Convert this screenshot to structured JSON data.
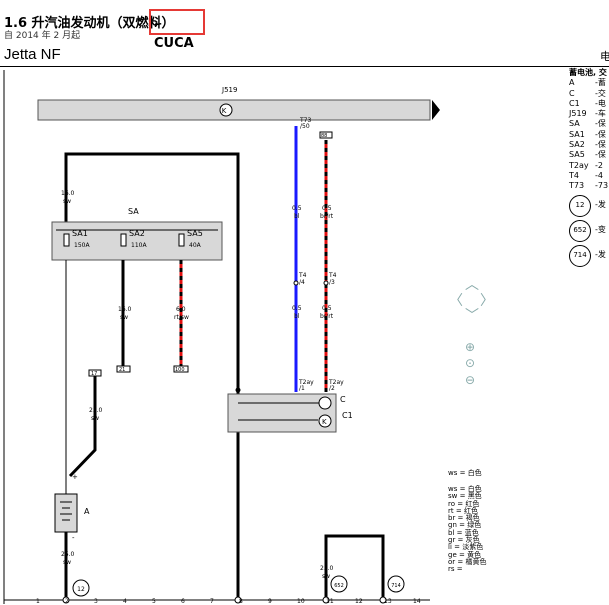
{
  "header": {
    "title": "1.6 升汽油发动机（双燃料）",
    "code": ", CUCA",
    "subtitle": "自 2014 年 2 月起",
    "model": "Jetta NF",
    "right_edge": "电"
  },
  "diagram": {
    "top_bar_label": "J519",
    "wire_t73": "T73\n/50",
    "wire_88": "88",
    "wire_gauge_blue": "0.5",
    "wire_color_blue": "bl",
    "wire_gauge_red": "0.5",
    "wire_color_red": "br/rt",
    "t4_a": "T4\n/4",
    "t4_b": "T4\n/3",
    "t2ay_a": "T2ay\n/1",
    "t2ay_b": "T2ay\n/2",
    "sa_label": "SA",
    "sa1": "SA1",
    "sa1_val": "150A",
    "sa2": "SA2",
    "sa2_val": "110A",
    "sa5": "SA5",
    "sa5_val": "40A",
    "left_top_gauge": "16.0",
    "left_top_color": "sw",
    "mid_gauge": "16.0",
    "mid_color": "sw",
    "red_gauge": "6.0",
    "red_color": "rt/sw",
    "box_21": "21",
    "box_100": "100",
    "box_17": "17",
    "battery_wire_gauge": "25.0",
    "battery_wire_color": "sw",
    "battery_label": "A",
    "bottom_gauge": "25.0",
    "bottom_color": "sw",
    "c_label": "C",
    "c1_label": "C1",
    "bot_right_gauge": "25.0",
    "bot_right_color": "sw",
    "circle_12": "12",
    "circle_652": "652",
    "circle_714": "714",
    "plus": "+",
    "minus": "-",
    "ground_numbers": [
      "1",
      "2",
      "3",
      "4",
      "5",
      "6",
      "7",
      "8",
      "9",
      "10",
      "11",
      "12",
      "13",
      "14"
    ]
  },
  "legend": {
    "title": "蓄电池, 交",
    "items": [
      {
        "k": "A",
        "v": "-蓄"
      },
      {
        "k": "C",
        "v": "-交"
      },
      {
        "k": "C1",
        "v": "-电"
      },
      {
        "k": "J519",
        "v": "-车"
      },
      {
        "k": "SA",
        "v": "-保"
      },
      {
        "k": "SA1",
        "v": "-保"
      },
      {
        "k": "SA2",
        "v": "-保"
      },
      {
        "k": "SA5",
        "v": "-保"
      },
      {
        "k": "T2ay",
        "v": "-2"
      },
      {
        "k": "T4",
        "v": "-4"
      },
      {
        "k": "T73",
        "v": "-73"
      }
    ],
    "circles": [
      {
        "n": "12",
        "v": "-发"
      },
      {
        "n": "652",
        "v": "-变"
      },
      {
        "n": "714",
        "v": "-发"
      }
    ]
  },
  "color_key": {
    "single": "ws = 白色",
    "list": [
      "ws = 白色",
      "sw = 黑色",
      "ro = 红色",
      "rt = 红色",
      "br = 褐色",
      "gn = 绿色",
      "bl = 蓝色",
      "gr = 灰色",
      "li = 淡紫色",
      "ge = 黄色",
      "or = 橘黄色",
      "rs = "
    ]
  },
  "colors": {
    "wire_blue": "#1a1aff",
    "wire_red": "#e01010",
    "component_fill": "#d8d8d8",
    "highlight": "#e53935"
  }
}
